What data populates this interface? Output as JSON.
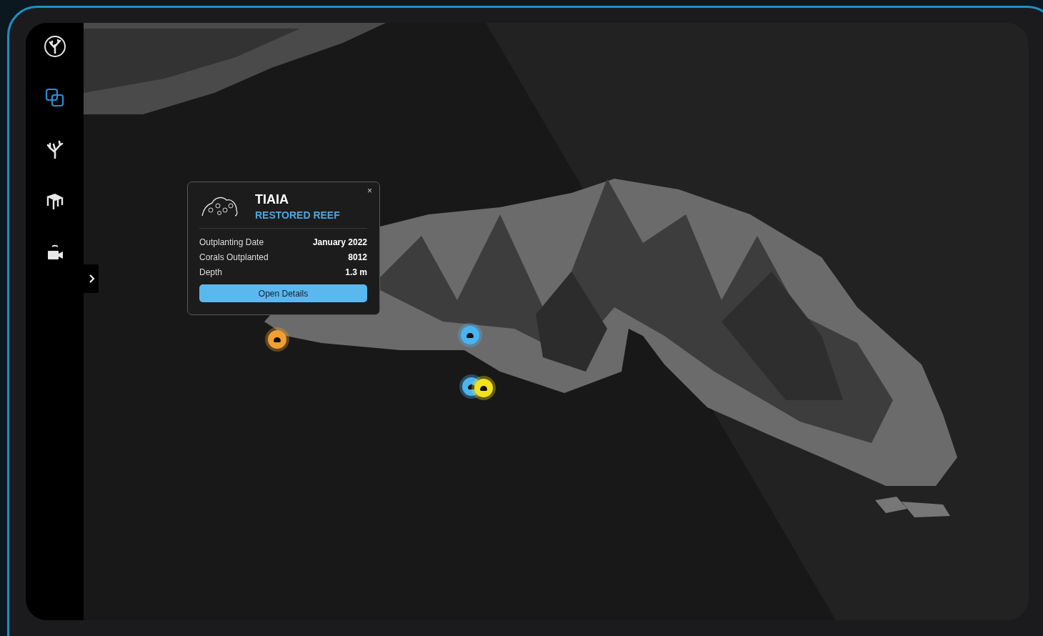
{
  "sidebar": {
    "items": [
      {
        "kind": "logo",
        "selected": false
      },
      {
        "kind": "layers",
        "selected": true
      },
      {
        "kind": "coral",
        "selected": false
      },
      {
        "kind": "structure",
        "selected": false
      },
      {
        "kind": "camera",
        "selected": false
      }
    ]
  },
  "map": {
    "kind": "picture",
    "markers": [
      {
        "color": "#f0a030"
      },
      {
        "color": "#4ab4f0"
      },
      {
        "color": "#4ab4f0"
      },
      {
        "color": "#f2e21c"
      }
    ]
  },
  "popup": {
    "close": "×",
    "title": "TIAIA",
    "subtitle": "RESTORED REEF",
    "details": [
      {
        "label": "Outplanting Date",
        "value": "January 2022"
      },
      {
        "label": "Corals Outplanted",
        "value": "8012"
      },
      {
        "label": "Depth",
        "value": "1.3 m"
      }
    ],
    "button": "Open Details"
  }
}
